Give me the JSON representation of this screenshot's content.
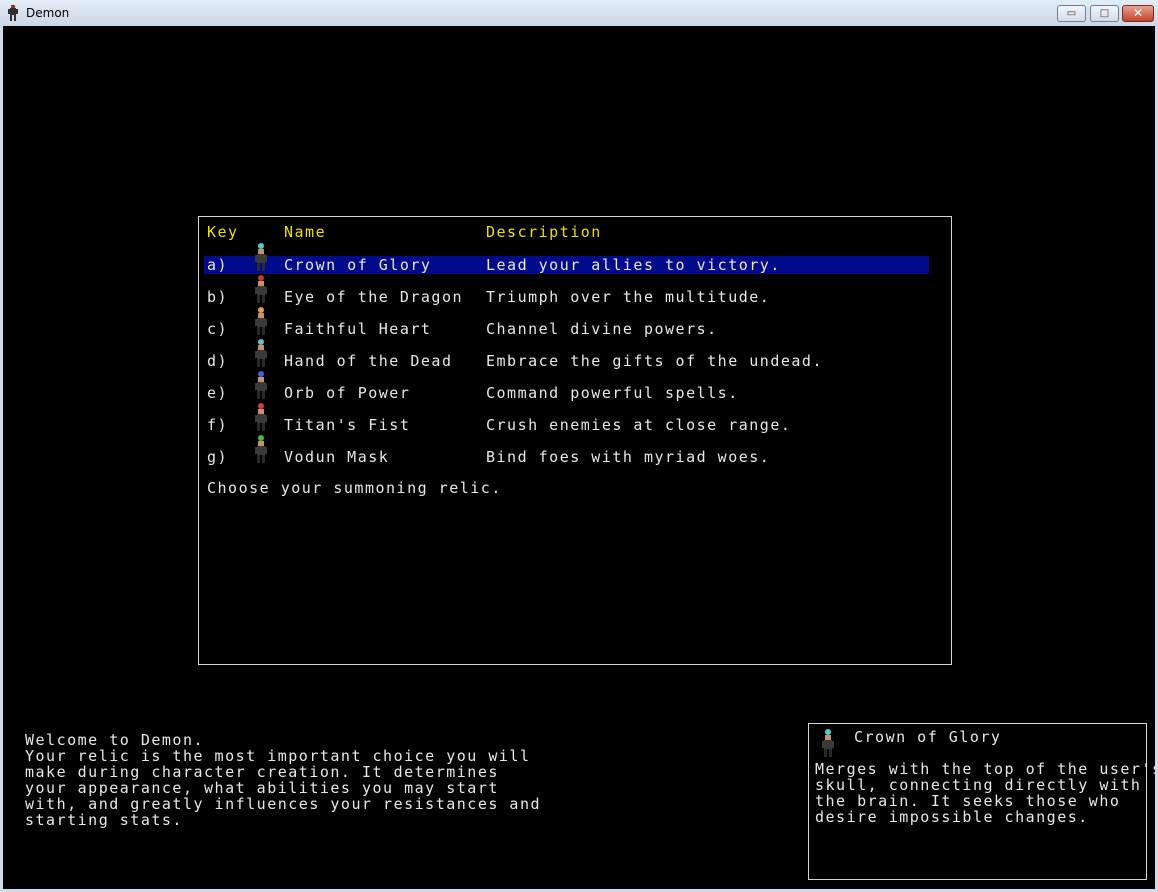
{
  "window": {
    "title": "Demon",
    "minimize": "▭",
    "maximize": "□",
    "close": "✕"
  },
  "menu": {
    "headers": {
      "key": "Key",
      "name": "Name",
      "description": "Description"
    },
    "items": [
      {
        "key": "a)",
        "name": "Crown of Glory",
        "description": "Lead your allies to victory.",
        "icon": "crown-of-glory-sprite",
        "color": "#4fd0c8"
      },
      {
        "key": "b)",
        "name": "Eye of the Dragon",
        "description": "Triumph over the multitude.",
        "icon": "eye-of-the-dragon-sprite",
        "color": "#c83a2a"
      },
      {
        "key": "c)",
        "name": "Faithful Heart",
        "description": "Channel divine powers.",
        "icon": "faithful-heart-sprite",
        "color": "#e0a040"
      },
      {
        "key": "d)",
        "name": "Hand of the Dead",
        "description": "Embrace the gifts of the undead.",
        "icon": "hand-of-the-dead-sprite",
        "color": "#60c0c0"
      },
      {
        "key": "e)",
        "name": "Orb of Power",
        "description": "Command powerful spells.",
        "icon": "orb-of-power-sprite",
        "color": "#4060e0"
      },
      {
        "key": "f)",
        "name": "Titan's Fist",
        "description": "Crush enemies at close range.",
        "icon": "titans-fist-sprite",
        "color": "#d04040"
      },
      {
        "key": "g)",
        "name": "Vodun Mask",
        "description": "Bind foes with myriad woes.",
        "icon": "vodun-mask-sprite",
        "color": "#40c040"
      }
    ],
    "prompt": "Choose your summoning relic."
  },
  "message": {
    "welcome": "Welcome to Demon.",
    "body": "Your relic is the most important choice you will\nmake during character creation. It determines\nyour appearance, what abilities you may start\nwith, and greatly influences your resistances and\nstarting stats."
  },
  "info": {
    "title": "Crown of Glory",
    "body": "Merges with the top of the user's\nskull, connecting directly with\nthe brain. It seeks those who\ndesire impossible changes."
  }
}
